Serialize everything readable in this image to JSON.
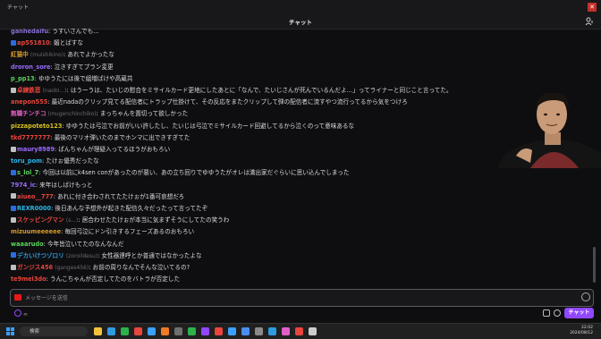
{
  "window": {
    "title": "チャット"
  },
  "header": {
    "title": "チャット"
  },
  "messages": [
    {
      "user": "ganhedaifu",
      "alt": "",
      "text": ": うすいさんでも…",
      "color": "#8a6fd8",
      "badge": ""
    },
    {
      "user": "ap551810",
      "alt": "",
      "text": ": 媚とばすな",
      "color": "#e8453c",
      "badge": "#2d6cdf"
    },
    {
      "user": "紅猫中",
      "alt": "(muishikino)",
      "text": ": あれでよかったな",
      "color": "#d69a2a",
      "badge": ""
    },
    {
      "user": "droron_sore",
      "alt": "",
      "text": ": 泣きすぎてプラン変更",
      "color": "#9b6bff",
      "badge": ""
    },
    {
      "user": "p_pp13",
      "alt": "",
      "text": ": ゆゆうたには後で組増ばけや高蔵共",
      "color": "#5bd35b",
      "badge": ""
    },
    {
      "user": "卓練鉄苣",
      "alt": "(naobi...)",
      "text": ": はうーうは、たいじの慰合をミサイルカード更地にしたあとに「なんで、たいじさんが死んでいるんだよ…」ってライナーと同じこと言ってた。",
      "color": "#e8453c",
      "badge": "#c0c0c0"
    },
    {
      "user": "anepon555",
      "alt": "",
      "text": ": 最近nadaのクリップ見てる配信者にトラップ仕掛けて、その反応をまたクリップして弾の配信者に流すやつ流行ってるから気をつけろ",
      "color": "#e8453c",
      "badge": ""
    },
    {
      "user": "無職チンチコ",
      "alt": "(mugenchinchiko)",
      "text": ": まっちゃんを置切って欲しかった",
      "color": "#e05fc6",
      "badge": ""
    },
    {
      "user": "pizzapoteto123",
      "alt": "",
      "text": ": ゆゆうたは弓泣でお前がいい許したし、たいじは弓泣でミサイルカード回避してるから泣くのって意味あるな",
      "color": "#d6c21e",
      "badge": ""
    },
    {
      "user": "tkd7777777",
      "alt": "",
      "text": ": 最後のマリオ弾いたのまでホンマに出できすぎてた",
      "color": "#e8453c",
      "badge": ""
    },
    {
      "user": "maury8989",
      "alt": "",
      "text": ": ぱんちゃんが理疑入ってるほうがおもろい",
      "color": "#9b6bff",
      "badge": "#c0c0c0"
    },
    {
      "user": "toru_pom",
      "alt": "",
      "text": ": たけぉ優秀だったな",
      "color": "#2bb5e8",
      "badge": ""
    },
    {
      "user": "s_lol_7",
      "alt": "",
      "text": ": 今回は以前にk4sen conがあったのが悪い、あの立ち回りでゆゆうたがオレは満出家だぐらいに思い込んでしまった",
      "color": "#5bd35b",
      "badge": "#2d6cdf"
    },
    {
      "user": "7974_ic",
      "alt": "",
      "text": ": 来年はしばけもっと",
      "color": "#9b6bff",
      "badge": ""
    },
    {
      "user": "aiueo__777",
      "alt": "",
      "text": ": あれに付き合わされてたたけぉが1番可哀想だろ",
      "color": "#e8453c",
      "badge": "#c0c0c0"
    },
    {
      "user": "REXR0000",
      "alt": "",
      "text": ": 後日あんな予想外が起きた配信久々だったって言ってたぞ",
      "color": "#2bb5e8",
      "badge": "#2d6cdf"
    },
    {
      "user": "スケッピングマン",
      "alt": "(s...)",
      "text": ": 居合わせたたけぉが本当に気まずそうにしてたの笑うわ",
      "color": "#e8453c",
      "badge": "#c0c0c0"
    },
    {
      "user": "mizuumeeeeee",
      "alt": "",
      "text": ": 毎回弓泣にドン引きするフェーズあるのおもろい",
      "color": "#d69a2a",
      "badge": ""
    },
    {
      "user": "waaarudo",
      "alt": "",
      "text": ": 今年皆泣いてたのなんなんだ",
      "color": "#5bd35b",
      "badge": ""
    },
    {
      "user": "デカいけつゾロリ",
      "alt": "(zoroildesu)",
      "text": ": 女性器連呼とか普通ではなかったよな",
      "color": "#2d9cdf",
      "badge": "#2d6cdf"
    },
    {
      "user": "ガンジス456",
      "alt": "(ganges456)",
      "text": ": お前の周りなんでそんな泣いてるの?",
      "color": "#e8453c",
      "badge": "#c0c0c0"
    },
    {
      "user": "te9mei3do",
      "alt": "",
      "text": ": うんこちゃんが否定してたのをバトラが否定した",
      "color": "#e8453c",
      "badge": ""
    }
  ],
  "input": {
    "placeholder": "メッセージを送信"
  },
  "points": {
    "value": "∞"
  },
  "send": {
    "label": "チャット"
  },
  "taskbar": {
    "search": "検索",
    "time": "22:02",
    "date": "2024/08/12"
  }
}
